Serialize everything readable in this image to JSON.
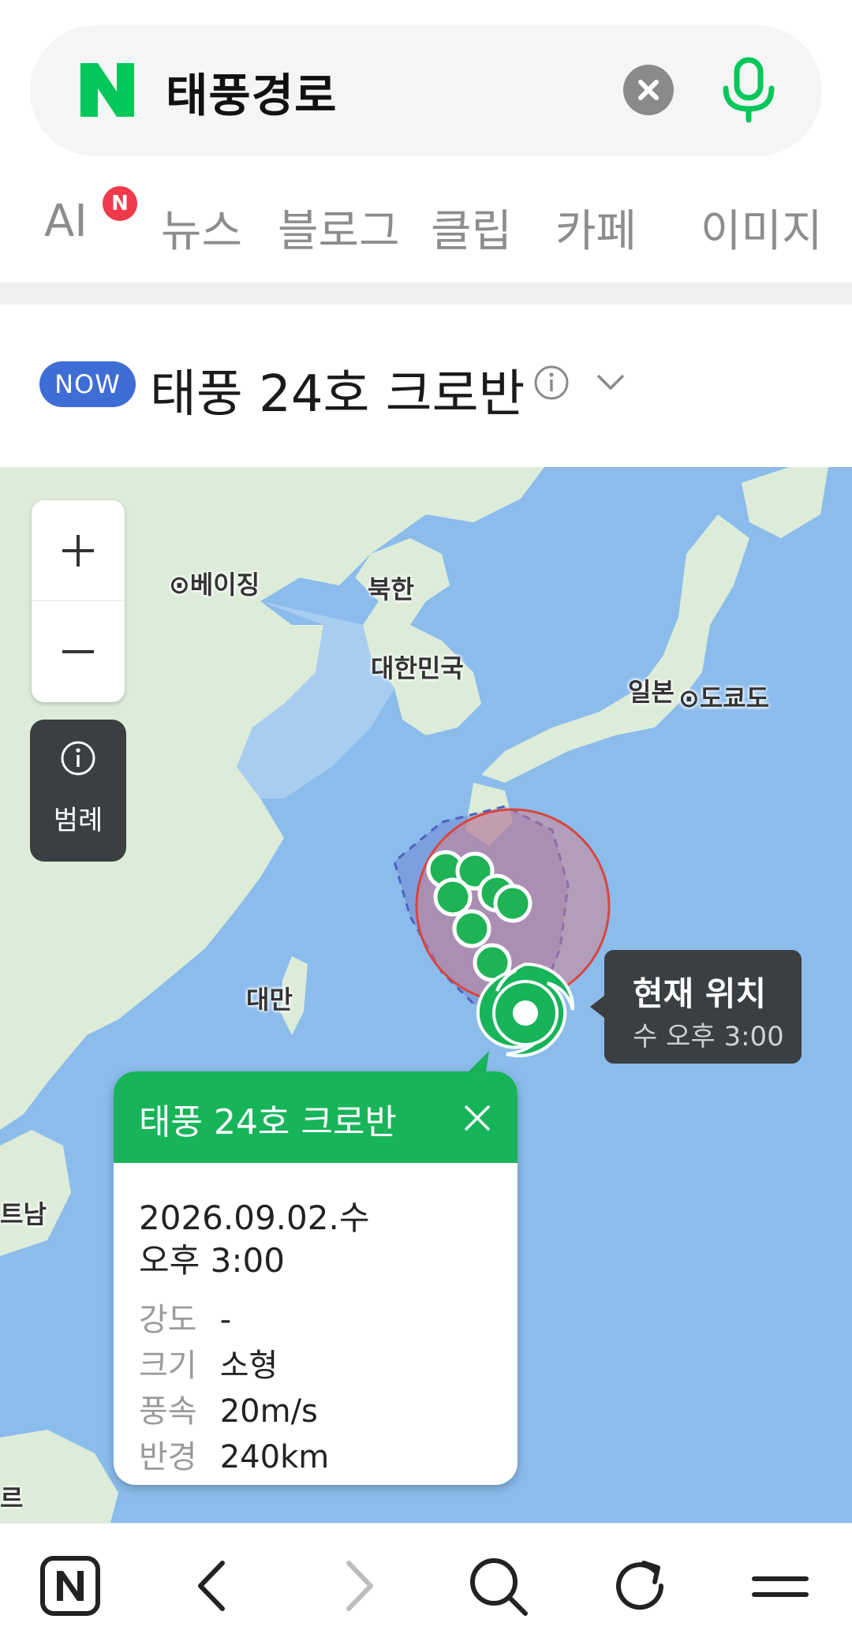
{
  "search": {
    "query": "태풍경로",
    "logo_letter": "N",
    "brand_color": "#03c75a"
  },
  "tabs": {
    "badge": "N",
    "items": [
      {
        "label": "AI"
      },
      {
        "label": "뉴스"
      },
      {
        "label": "블로그"
      },
      {
        "label": "클립"
      },
      {
        "label": "카페"
      },
      {
        "label": "이미지"
      }
    ]
  },
  "typhoon": {
    "now_badge": "NOW",
    "title": "태풍 24호 크로반"
  },
  "map": {
    "legend_label": "범례",
    "places": {
      "beijing": "베이징",
      "north_korea": "북한",
      "south_korea": "대한민국",
      "japan": "일본",
      "tokyo": "도쿄도",
      "taiwan": "대만",
      "vietnam": "트남",
      "edge_label": "르"
    },
    "current_position": {
      "title": "현재 위치",
      "time": "수 오후 3:00"
    },
    "popup": {
      "title": "태풍 24호 크로반",
      "date": "2026.09.02.수",
      "time": "오후 3:00",
      "stats": [
        {
          "label": "강도",
          "value": "-"
        },
        {
          "label": "크기",
          "value": "소형"
        },
        {
          "label": "풍속",
          "value": "20m/s"
        },
        {
          "label": "반경",
          "value": "240km"
        }
      ]
    },
    "colors": {
      "sea": "#8bbcec",
      "land": "#dcecd8",
      "track": "#1fb356",
      "forecast_red": "#d9463e",
      "forecast_blue": "#6a7fd0"
    }
  }
}
